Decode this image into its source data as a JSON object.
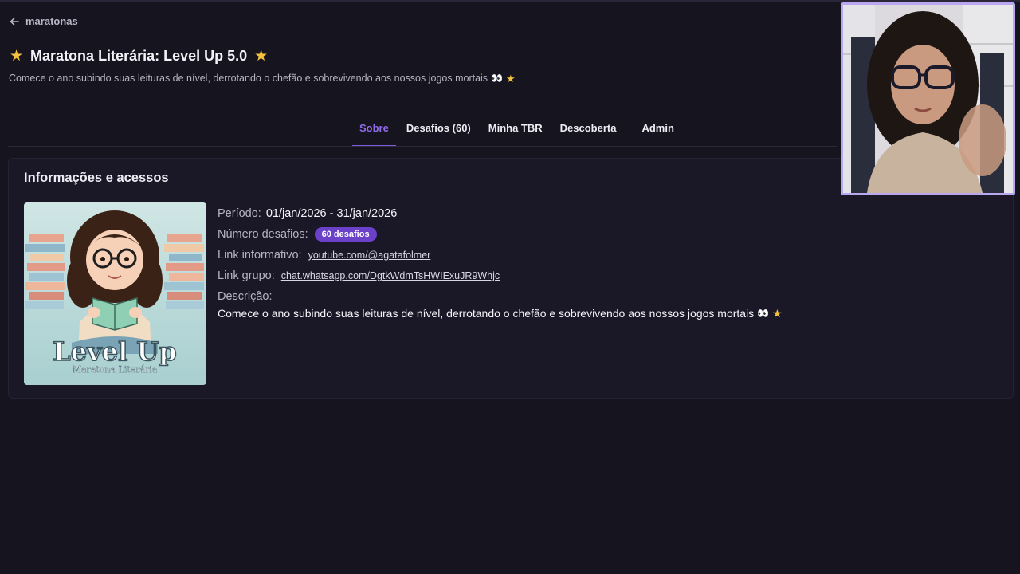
{
  "nav": {
    "back_label": "maratonas"
  },
  "header": {
    "title": "Maratona Literária: Level Up 5.0",
    "subtitle": "Comece o ano subindo suas leituras de nível, derrotando o chefão e sobrevivendo aos nossos jogos mortais",
    "subtitle_emoji": "👀",
    "star": "★"
  },
  "tabs": [
    {
      "label": "Sobre",
      "active": true
    },
    {
      "label": "Desafios (60)"
    },
    {
      "label": "Minha TBR"
    },
    {
      "label": "Descoberta"
    },
    {
      "label": "Admin"
    }
  ],
  "info_card": {
    "title": "Informações e acessos",
    "cover": {
      "title": "Level Up",
      "subtitle": "Maratona Literária"
    },
    "period_label": "Período:",
    "period_value": "01/jan/2026 - 31/jan/2026",
    "challenges_label": "Número desafios:",
    "challenges_badge": "60 desafios",
    "info_link_label": "Link informativo:",
    "info_link": "youtube.com/@agatafolmer",
    "group_link_label": "Link grupo:",
    "group_link": "chat.whatsapp.com/DgtkWdmTsHWIExuJR9Whjc",
    "description_label": "Descrição:",
    "description": "Comece o ano subindo suas leituras de nível, derrotando o chefão e sobrevivendo aos nossos jogos mortais",
    "description_emoji": "👀"
  },
  "colors": {
    "background": "#16141f",
    "accent": "#7f5bdb",
    "badge": "#6a41c8",
    "star": "#f5c23b"
  },
  "icons": {
    "back": "arrow-left-icon",
    "star": "star-icon",
    "eyes": "eyes-emoji"
  }
}
